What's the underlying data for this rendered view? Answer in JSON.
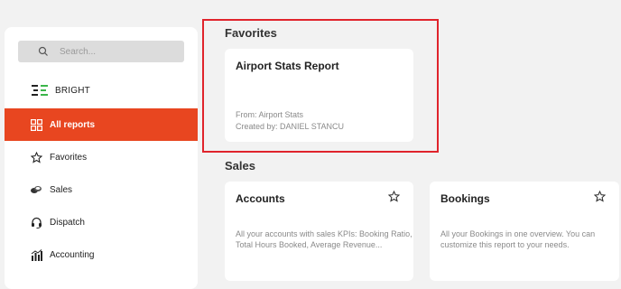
{
  "sidebar": {
    "search_placeholder": "Search...",
    "brand_name": "BRIGHT",
    "items": [
      {
        "label": "All reports",
        "icon": "grid-icon"
      },
      {
        "label": "Favorites",
        "icon": "star-icon"
      },
      {
        "label": "Sales",
        "icon": "coins-icon"
      },
      {
        "label": "Dispatch",
        "icon": "headset-icon"
      },
      {
        "label": "Accounting",
        "icon": "bar-chart-icon"
      }
    ]
  },
  "sections": {
    "favorites": {
      "title": "Favorites",
      "card": {
        "title": "Airport Stats Report",
        "from": "From: Airport Stats",
        "created_by": "Created by: DANIEL STANCU"
      }
    },
    "sales": {
      "title": "Sales",
      "cards": [
        {
          "title": "Accounts",
          "description": "All your accounts with sales KPIs: Booking Ratio, Total Hours Booked, Average Revenue..."
        },
        {
          "title": "Bookings",
          "description": "All your Bookings in one overview. You can customize this report to your needs."
        }
      ]
    }
  },
  "colors": {
    "accent": "#e84620",
    "highlight": "#e0242c",
    "background": "#f2f2f2"
  }
}
